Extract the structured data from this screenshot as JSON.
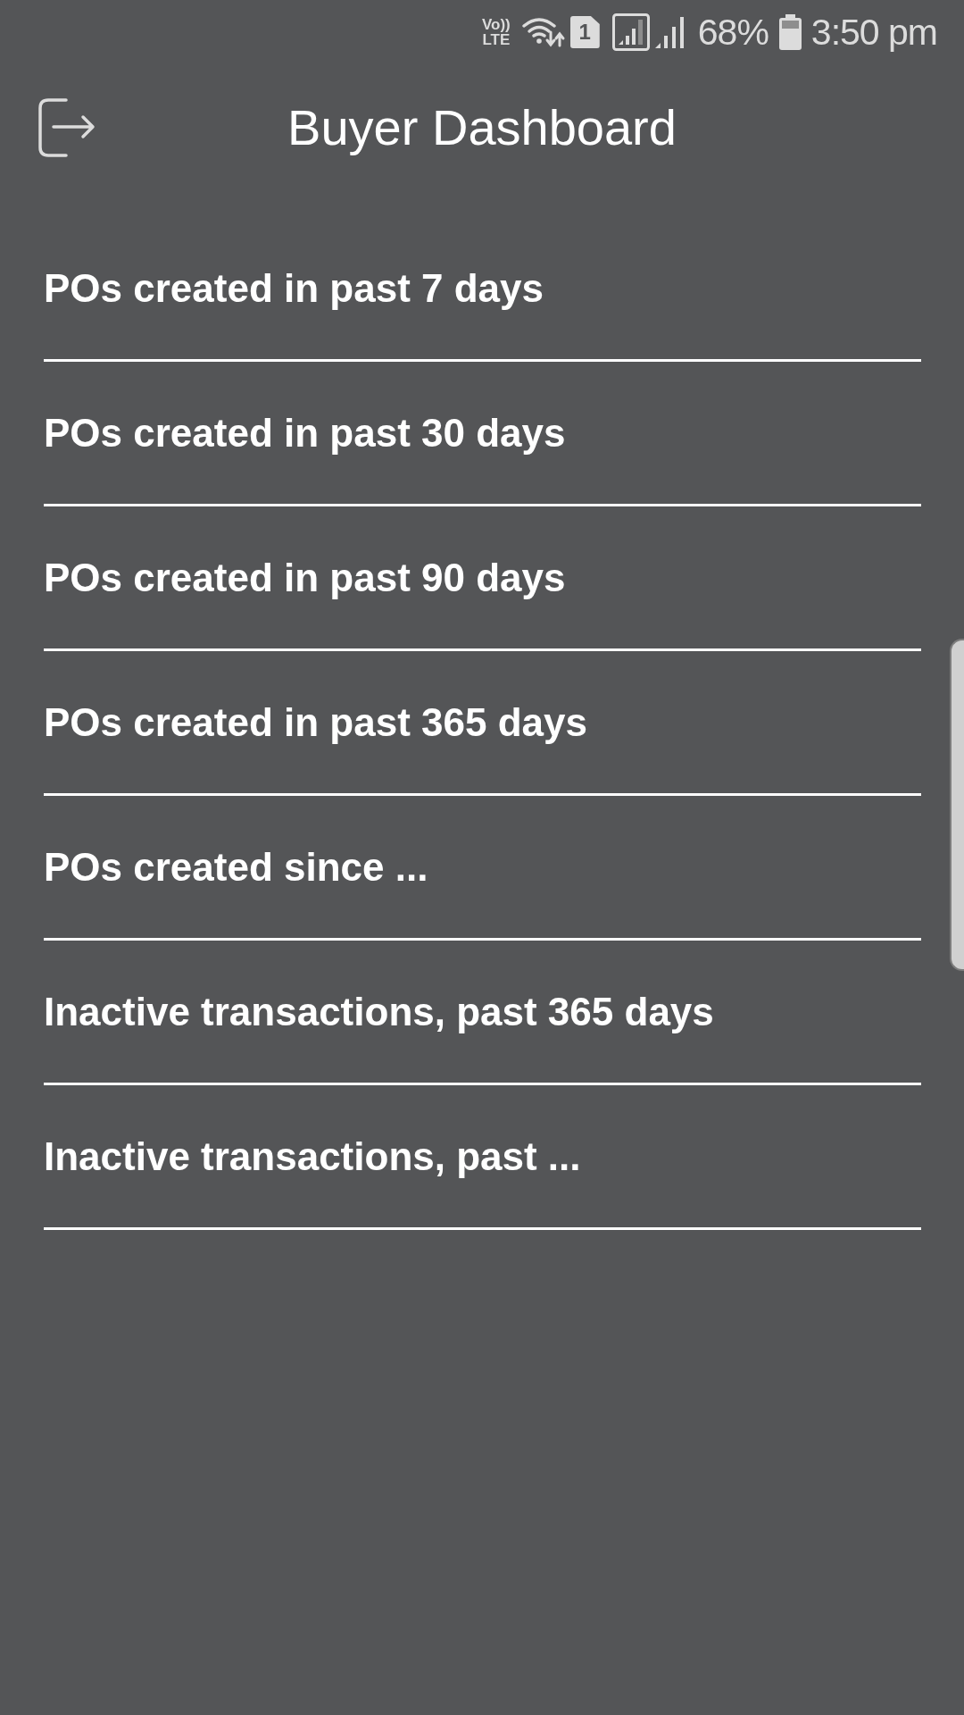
{
  "status_bar": {
    "network_badge": [
      "Vo))",
      "LTE"
    ],
    "sim_slot": "1",
    "battery": "68%",
    "time": "3:50 pm"
  },
  "header": {
    "title": "Buyer Dashboard"
  },
  "items": [
    {
      "label": "POs created in past 7 days"
    },
    {
      "label": "POs created in past 30 days"
    },
    {
      "label": "POs created in past 90 days"
    },
    {
      "label": "POs created in past 365 days"
    },
    {
      "label": "POs created since ..."
    },
    {
      "label": "Inactive transactions, past 365 days"
    },
    {
      "label": "Inactive transactions, past ..."
    }
  ]
}
